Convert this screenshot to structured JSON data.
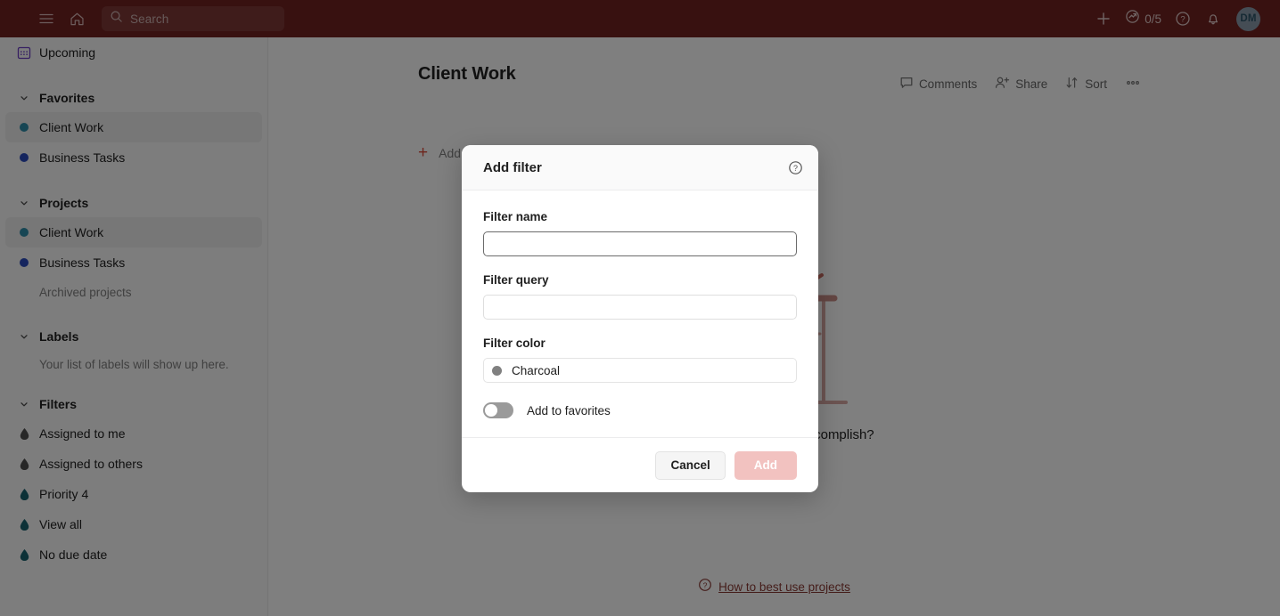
{
  "topbar": {
    "menu_icon": "hamburger-menu-icon",
    "home_icon": "home-icon",
    "search_placeholder": "Search",
    "add_icon": "plus-icon",
    "karma_icon": "productivity-icon",
    "karma_value": "0/5",
    "help_icon": "question-circle-icon",
    "notifications_icon": "bell-icon",
    "avatar_initials": "DM",
    "bg_color": "#702321"
  },
  "sidebar": {
    "upcoming": {
      "label": "Upcoming",
      "icon": "calendar-upcoming-icon",
      "icon_color": "#6c3fc4"
    },
    "favorites": {
      "title": "Favorites",
      "items": [
        {
          "label": "Client Work",
          "dot_color": "#2f8ca8",
          "active": true
        },
        {
          "label": "Business Tasks",
          "dot_color": "#2b4bbd",
          "active": false
        }
      ]
    },
    "projects": {
      "title": "Projects",
      "items": [
        {
          "label": "Client Work",
          "dot_color": "#2f8ca8",
          "active": true
        },
        {
          "label": "Business Tasks",
          "dot_color": "#2b4bbd",
          "active": false
        }
      ],
      "archived_label": "Archived projects"
    },
    "labels": {
      "title": "Labels",
      "empty_text": "Your list of labels will show up here."
    },
    "filters": {
      "title": "Filters",
      "items": [
        {
          "label": "Assigned to me",
          "icon_color": "#4f4f4f"
        },
        {
          "label": "Assigned to others",
          "icon_color": "#4f4f4f"
        },
        {
          "label": "Priority 4",
          "icon_color": "#18626f"
        },
        {
          "label": "View all",
          "icon_color": "#18626f"
        },
        {
          "label": "No due date",
          "icon_color": "#18626f"
        }
      ]
    }
  },
  "main": {
    "title": "Client Work",
    "add_task_label": "Add task",
    "toolbar": [
      {
        "label": "Comments",
        "icon": "comment-icon"
      },
      {
        "label": "Share",
        "icon": "person-add-icon"
      },
      {
        "label": "Sort",
        "icon": "sort-arrows-icon"
      },
      {
        "label": "",
        "icon": "more-options-icon"
      }
    ],
    "empty_state": {
      "heading": "What do you want to accomplish?",
      "illustration": "easel-illustration"
    },
    "help_link": {
      "label": "How to best use projects",
      "icon": "question-circle-icon",
      "color": "#8a3a34"
    }
  },
  "modal": {
    "title": "Add filter",
    "help_icon": "question-circle-icon",
    "fields": {
      "name": {
        "label": "Filter name",
        "value": "",
        "focused": true
      },
      "query": {
        "label": "Filter query",
        "value": ""
      },
      "color": {
        "label": "Filter color",
        "value": "Charcoal",
        "swatch_color": "#808080"
      }
    },
    "toggle": {
      "label": "Add to favorites",
      "state": "off"
    },
    "buttons": {
      "cancel": "Cancel",
      "add": "Add",
      "add_disabled": true,
      "add_bg": "#f2c2c0"
    }
  }
}
